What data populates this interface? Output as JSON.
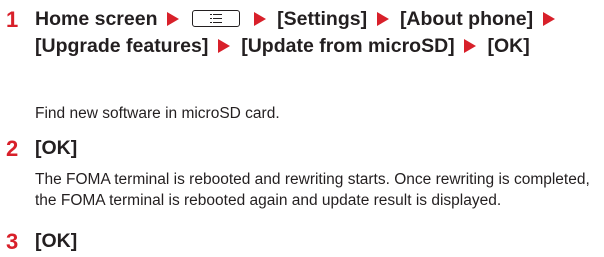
{
  "steps": [
    {
      "number": "1",
      "parts": [
        "Home screen",
        "[Settings]",
        "[About phone]",
        "[Upgrade features]",
        "[Update from microSD]",
        "[OK]"
      ],
      "description": "Find new software in microSD card."
    },
    {
      "number": "2",
      "heading": "[OK]",
      "description": "The FOMA terminal is rebooted and rewriting starts. Once rewriting is completed, the FOMA terminal is rebooted again and update result is displayed."
    },
    {
      "number": "3",
      "heading": "[OK]"
    }
  ],
  "colors": {
    "accent": "#d8202a",
    "text": "#231f20"
  },
  "icons": {
    "menu_key": "menu-key-icon",
    "arrow": "right-triangle-arrow-icon"
  }
}
